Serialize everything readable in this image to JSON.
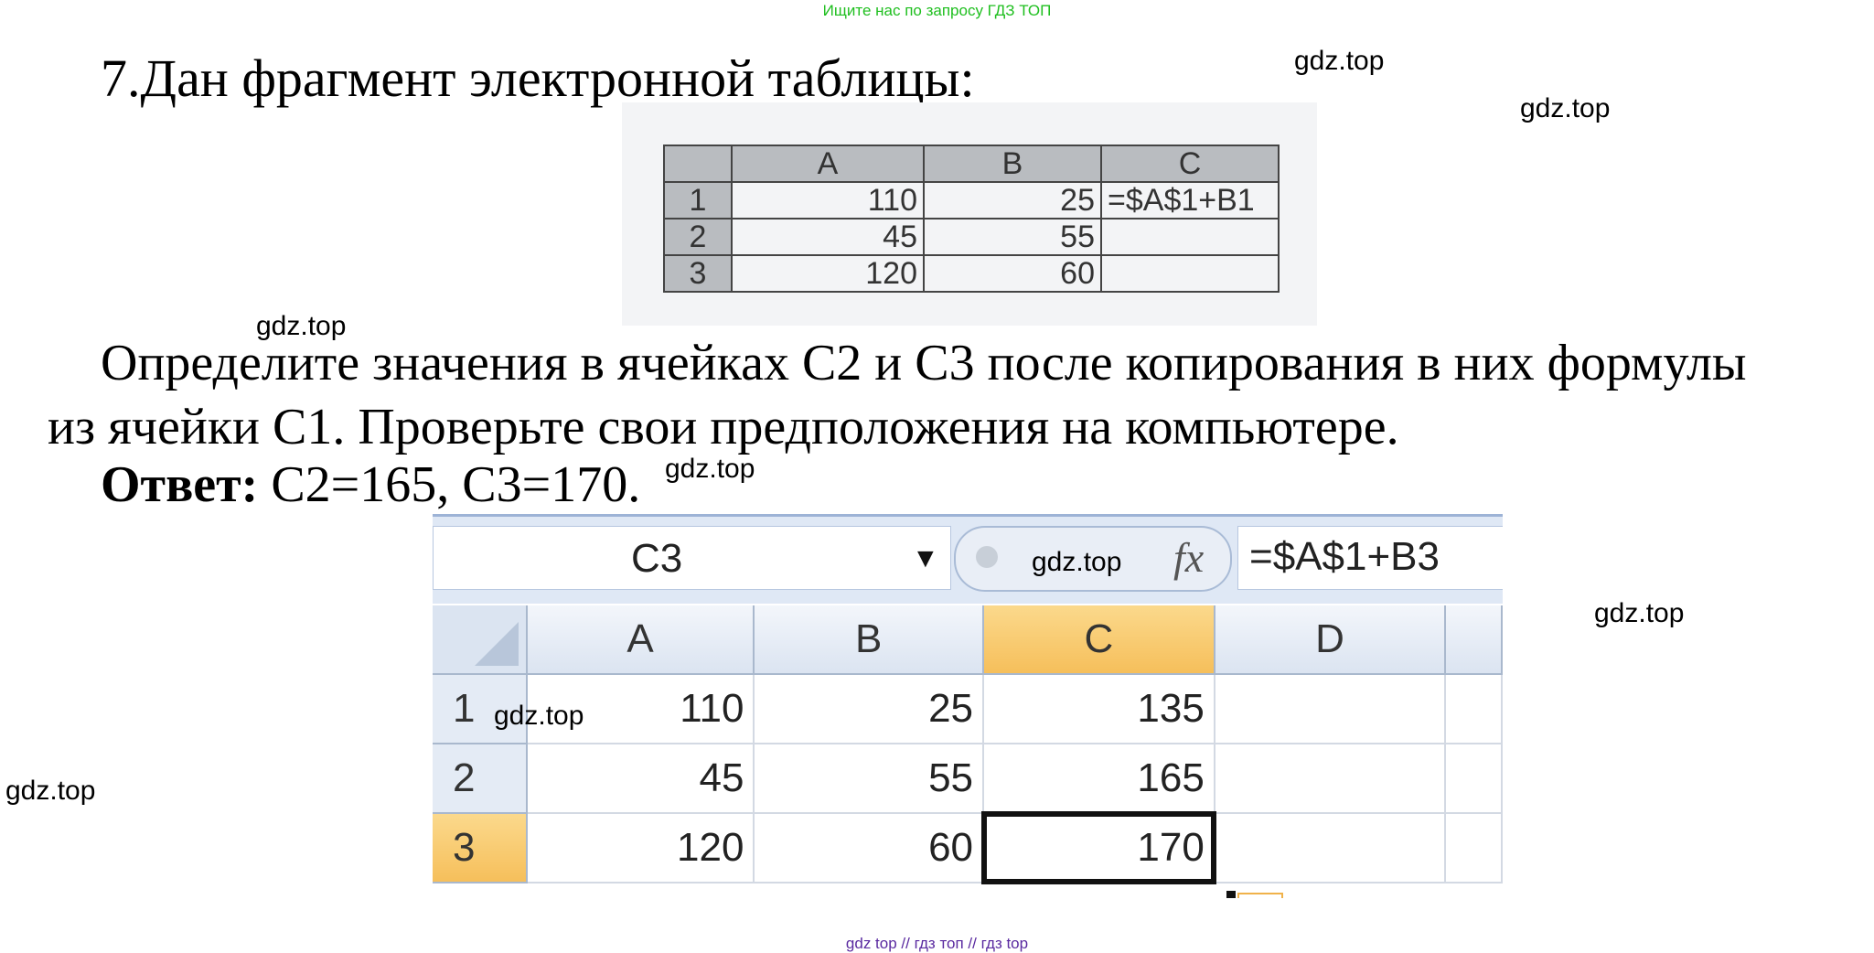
{
  "top_link": "Ищите нас по запросу ГДЗ ТОП",
  "task": {
    "title": "7.Дан фрагмент электронной таблицы:",
    "question_line1": "Определите значения в ячейках С2 и С3 после копирования в них формулы",
    "question_line2": "из ячейки С1. Проверьте свои предположения на компьютере.",
    "answer_label": "Ответ:",
    "answer_text": " С2=165, С3=170."
  },
  "scan_table": {
    "headers": [
      "A",
      "B",
      "C"
    ],
    "rows": [
      {
        "row": "1",
        "a": "110",
        "b": "25",
        "c": "=$A$1+B1"
      },
      {
        "row": "2",
        "a": "45",
        "b": "55",
        "c": ""
      },
      {
        "row": "3",
        "a": "120",
        "b": "60",
        "c": ""
      }
    ]
  },
  "excel": {
    "name_box": "C3",
    "fx_label": "fx",
    "formula": "=$A$1+B3",
    "columns": [
      "A",
      "B",
      "C",
      "D"
    ],
    "rows": [
      {
        "row": "1",
        "a": "110",
        "b": "25",
        "c": "135",
        "d": ""
      },
      {
        "row": "2",
        "a": "45",
        "b": "55",
        "c": "165",
        "d": ""
      },
      {
        "row": "3",
        "a": "120",
        "b": "60",
        "c": "170",
        "d": ""
      }
    ]
  },
  "watermark": "gdz.top",
  "footer": "gdz top  //  гдз топ  //  гдз top"
}
